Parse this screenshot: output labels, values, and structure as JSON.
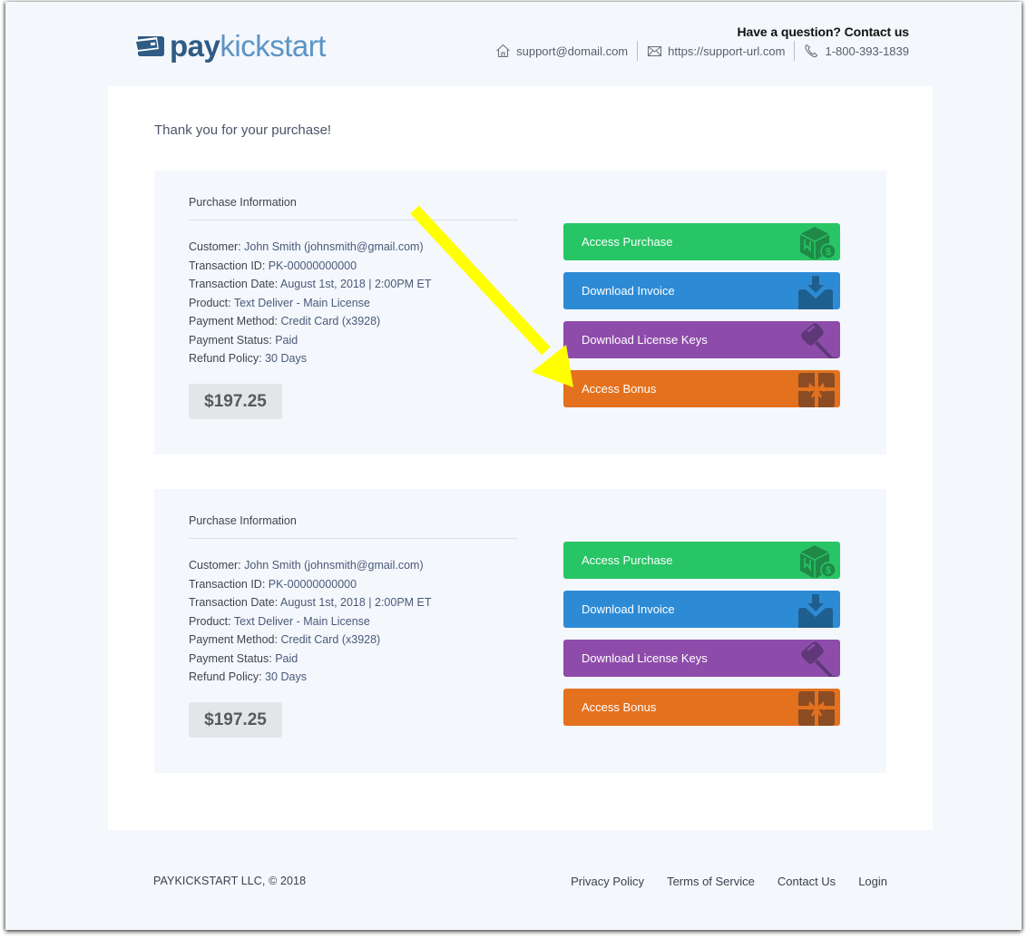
{
  "brand": {
    "name_part1": "pay",
    "name_part2": "kickstart",
    "logo_icon": "wallet-card-icon",
    "colors": {
      "dark": "#2f5b84",
      "light": "#5b94c6"
    }
  },
  "header": {
    "contact_title": "Have a question? Contact us",
    "contacts": [
      {
        "icon": "home-icon",
        "text": "support@domail.com"
      },
      {
        "icon": "envelope-icon",
        "text": "https://support-url.com"
      },
      {
        "icon": "phone-icon",
        "text": "1-800-393-1839"
      }
    ]
  },
  "main": {
    "thanks_message": "Thank you for your purchase!",
    "purchases": [
      {
        "section_title": "Purchase Information",
        "fields": [
          {
            "label": "Customer:",
            "value": "John Smith (johnsmith@gmail.com)"
          },
          {
            "label": "Transaction ID:",
            "value": "PK-00000000000"
          },
          {
            "label": "Transaction Date:",
            "value": "August 1st, 2018 | 2:00PM ET"
          },
          {
            "label": "Product:",
            "value": "Text Deliver - Main License"
          },
          {
            "label": "Payment Method:",
            "value": "Credit Card (x3928)"
          },
          {
            "label": "Payment Status:",
            "value": "Paid"
          },
          {
            "label": "Refund Policy:",
            "value": "30 Days"
          }
        ],
        "price": "$197.25",
        "actions": [
          {
            "label": "Access Purchase",
            "icon": "box-dollar-icon",
            "color": "#28c566"
          },
          {
            "label": "Download Invoice",
            "icon": "download-tray-icon",
            "color": "#2d8bd6"
          },
          {
            "label": "Download License Keys",
            "icon": "key-icon",
            "color": "#8e4caa"
          },
          {
            "label": "Access Bonus",
            "icon": "gift-icon",
            "color": "#e4711e"
          }
        ]
      },
      {
        "section_title": "Purchase Information",
        "fields": [
          {
            "label": "Customer:",
            "value": "John Smith (johnsmith@gmail.com)"
          },
          {
            "label": "Transaction ID:",
            "value": "PK-00000000000"
          },
          {
            "label": "Transaction Date:",
            "value": "August 1st, 2018 | 2:00PM ET"
          },
          {
            "label": "Product:",
            "value": "Text Deliver - Main License"
          },
          {
            "label": "Payment Method:",
            "value": "Credit Card (x3928)"
          },
          {
            "label": "Payment Status:",
            "value": "Paid"
          },
          {
            "label": "Refund Policy:",
            "value": "30 Days"
          }
        ],
        "price": "$197.25",
        "actions": [
          {
            "label": "Access Purchase",
            "icon": "box-dollar-icon",
            "color": "#28c566"
          },
          {
            "label": "Download Invoice",
            "icon": "download-tray-icon",
            "color": "#2d8bd6"
          },
          {
            "label": "Download License Keys",
            "icon": "key-icon",
            "color": "#8e4caa"
          },
          {
            "label": "Access Bonus",
            "icon": "gift-icon",
            "color": "#e4711e"
          }
        ]
      }
    ]
  },
  "annotation": {
    "type": "arrow",
    "color": "#ffff00",
    "points_to": "Access Bonus"
  },
  "footer": {
    "copyright": "PAYKICKSTART LLC, © 2018",
    "links": [
      "Privacy Policy",
      "Terms of Service",
      "Contact Us",
      "Login"
    ]
  }
}
